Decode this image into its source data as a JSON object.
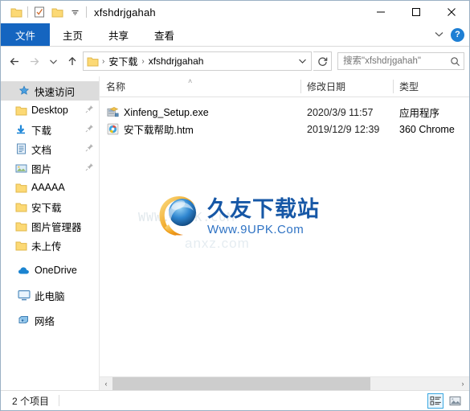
{
  "window": {
    "title": "xfshdrjgahah",
    "quick_access_toolbar": [
      {
        "name": "folder-icon",
        "label": ""
      },
      {
        "name": "properties-icon",
        "label": ""
      },
      {
        "name": "new-folder-icon",
        "label": ""
      },
      {
        "name": "customize-dropdown-icon",
        "label": ""
      }
    ],
    "controls": {
      "minimize": "─",
      "maximize": "☐",
      "close": "✕"
    }
  },
  "ribbon": {
    "tabs": [
      {
        "label": "文件",
        "active": true
      },
      {
        "label": "主页",
        "active": false
      },
      {
        "label": "共享",
        "active": false
      },
      {
        "label": "查看",
        "active": false
      }
    ],
    "collapse_label": "⌄",
    "help_label": "?"
  },
  "address": {
    "back": "←",
    "forward": "→",
    "recent": "⌄",
    "up": "↑",
    "breadcrumbs": [
      "安下载",
      "xfshdrjgahah"
    ],
    "separator": "›",
    "dropdown": "⌄",
    "refresh": "↻"
  },
  "search": {
    "placeholder": "搜索\"xfshdrjgahah\"",
    "value": "",
    "icon": "search-icon"
  },
  "sidebar": {
    "groups": [
      {
        "header": {
          "label": "快速访问",
          "icon": "star-pin-icon",
          "selected": true
        },
        "items": [
          {
            "label": "Desktop",
            "icon": "folder-icon",
            "pinned": true
          },
          {
            "label": "下载",
            "icon": "download-icon",
            "pinned": true
          },
          {
            "label": "文档",
            "icon": "documents-icon",
            "pinned": true
          },
          {
            "label": "图片",
            "icon": "pictures-icon",
            "pinned": true
          },
          {
            "label": "AAAAA",
            "icon": "folder-icon",
            "pinned": false
          },
          {
            "label": "安下载",
            "icon": "folder-icon",
            "pinned": false
          },
          {
            "label": "图片管理器",
            "icon": "folder-icon",
            "pinned": false
          },
          {
            "label": "未上传",
            "icon": "folder-icon",
            "pinned": false
          }
        ]
      },
      {
        "header": {
          "label": "OneDrive",
          "icon": "cloud-icon",
          "selected": false
        },
        "items": []
      },
      {
        "header": {
          "label": "此电脑",
          "icon": "computer-icon",
          "selected": false
        },
        "items": []
      },
      {
        "header": {
          "label": "网络",
          "icon": "network-icon",
          "selected": false
        },
        "items": []
      }
    ]
  },
  "filelist": {
    "columns": [
      {
        "label": "名称",
        "sorted": true
      },
      {
        "label": "修改日期",
        "sorted": false
      },
      {
        "label": "类型",
        "sorted": false
      }
    ],
    "sort_indicator": "˄",
    "rows": [
      {
        "name": "Xinfeng_Setup.exe",
        "date": "2020/3/9 11:57",
        "type": "应用程序",
        "icon": "installer-icon"
      },
      {
        "name": "安下载帮助.htm",
        "date": "2019/12/9 12:39",
        "type": "360 Chrome",
        "icon": "browser-html-icon"
      }
    ]
  },
  "watermark": {
    "faint_text": "WWW.9UPK.COM",
    "faint_text2": "anxz.com",
    "brand_cn": "久友下载站",
    "brand_en": "Www.9UPK.Com"
  },
  "scrollbar": {
    "left_arrow": "‹",
    "right_arrow": "›"
  },
  "status": {
    "item_count": "2 个项目",
    "view_details": "details-view-icon",
    "view_large_icons": "large-icons-view-icon"
  },
  "colors": {
    "accent_blue": "#1565c0",
    "folder_yellow": "#ffd966",
    "selection_blue": "#cde8ff",
    "brand_blue": "#1657a6",
    "brand_orange": "#f5a623"
  }
}
